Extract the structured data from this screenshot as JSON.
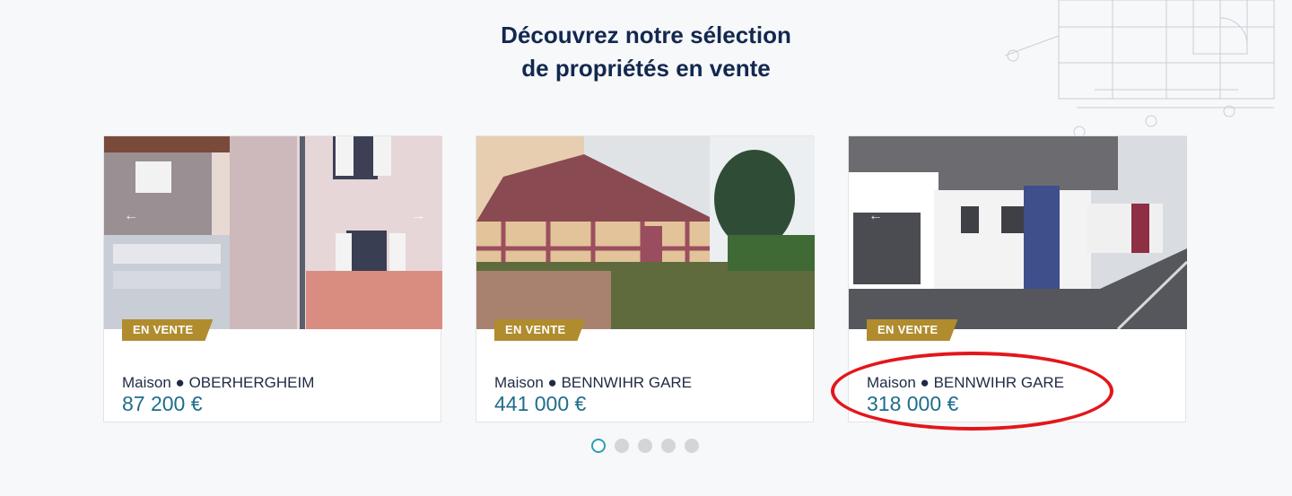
{
  "section": {
    "title_line1": "Découvrez notre sélection",
    "title_line2": "de propriétés en vente"
  },
  "properties": [
    {
      "badge": "EN VENTE",
      "type": "Maison",
      "separator": "●",
      "city": "OBERHERGHEIM",
      "price": "87 200 €"
    },
    {
      "badge": "EN VENTE",
      "type": "Maison",
      "separator": "●",
      "city": "BENNWIHR GARE",
      "price": "441 000 €"
    },
    {
      "badge": "EN VENTE",
      "type": "Maison",
      "separator": "●",
      "city": "BENNWIHR GARE",
      "price": "318 000 €"
    }
  ],
  "carousel": {
    "pages": 5,
    "active_page": 1
  },
  "icons": {
    "prev": "arrow-left-icon",
    "next": "arrow-right-icon"
  },
  "colors": {
    "heading": "#13284f",
    "price": "#1f6d8c",
    "badge": "#b08c2e",
    "annotation": "#e3161b"
  }
}
